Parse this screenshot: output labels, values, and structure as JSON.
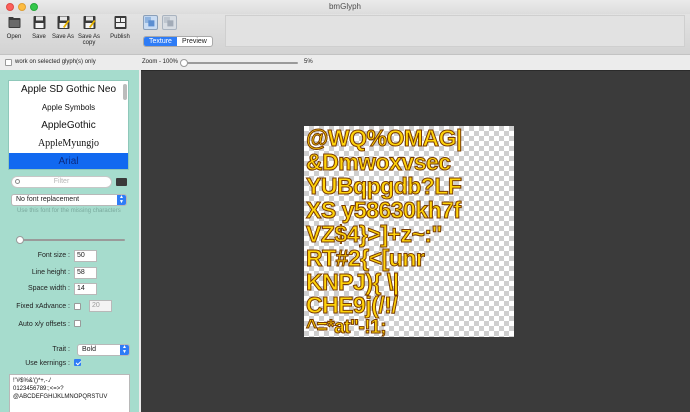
{
  "window": {
    "title": "bmGlyph"
  },
  "toolbar": {
    "buttons": [
      {
        "label": "Open"
      },
      {
        "label": "Save"
      },
      {
        "label": "Save As"
      },
      {
        "label": "Save As copy"
      },
      {
        "label": "Publish"
      }
    ],
    "view_tabs": {
      "texture": "Texture",
      "preview": "Preview",
      "selected": "Texture"
    }
  },
  "options": {
    "selected_only_label": "work on selected glyph(s) only",
    "selected_only_checked": false,
    "zoom_label": "Zoom - 100%",
    "zoom_max": "5%",
    "zoom_percent": 100
  },
  "sidebar": {
    "fonts": [
      "Apple SD Gothic Neo",
      "Apple Symbols",
      "AppleGothic",
      "AppleMyungjo",
      "Arial"
    ],
    "selected_font": "Arial",
    "filter_placeholder": "Filter",
    "replacement": "No font replacement",
    "replacement_hint": "Use this font for the missing characters",
    "font_size_label": "Font size :",
    "font_size": "50",
    "line_height_label": "Line height :",
    "line_height": "58",
    "space_width_label": "Space width :",
    "space_width": "14",
    "fixed_xadvance_label": "Fixed xAdvance :",
    "fixed_xadvance": "20",
    "fixed_xadvance_checked": false,
    "auto_offsets_label": "Auto x/y offsets :",
    "auto_offsets_checked": false,
    "trait_label": "Trait :",
    "trait": "Bold",
    "use_kernings_label": "Use kernings :",
    "use_kernings_checked": true,
    "charset_lines": [
      "!\"#$%&'()*+,-./",
      "0123456789:;<=>?",
      "@ABCDEFGHIJKLMNOPQRSTUV"
    ]
  },
  "texture": {
    "rows": [
      "@WQ%OMAG|",
      "&Dmwoxvsec",
      "YUBqpgdb?LF",
      "XS y58630kh7f",
      "VZ$4}>]+z~:\"",
      "RT#2{<[unr",
      "KNPJ){ \\|",
      "CHE9j(/!/",
      "^=*at\"-!1;"
    ]
  },
  "colors": {
    "accent": "#2e7cf6",
    "sidebar_bg": "#a6dccd",
    "canvas_bg": "#3b3b3b",
    "glyph_fill": "#ffd40a",
    "glyph_outline": "#7a3b00"
  }
}
